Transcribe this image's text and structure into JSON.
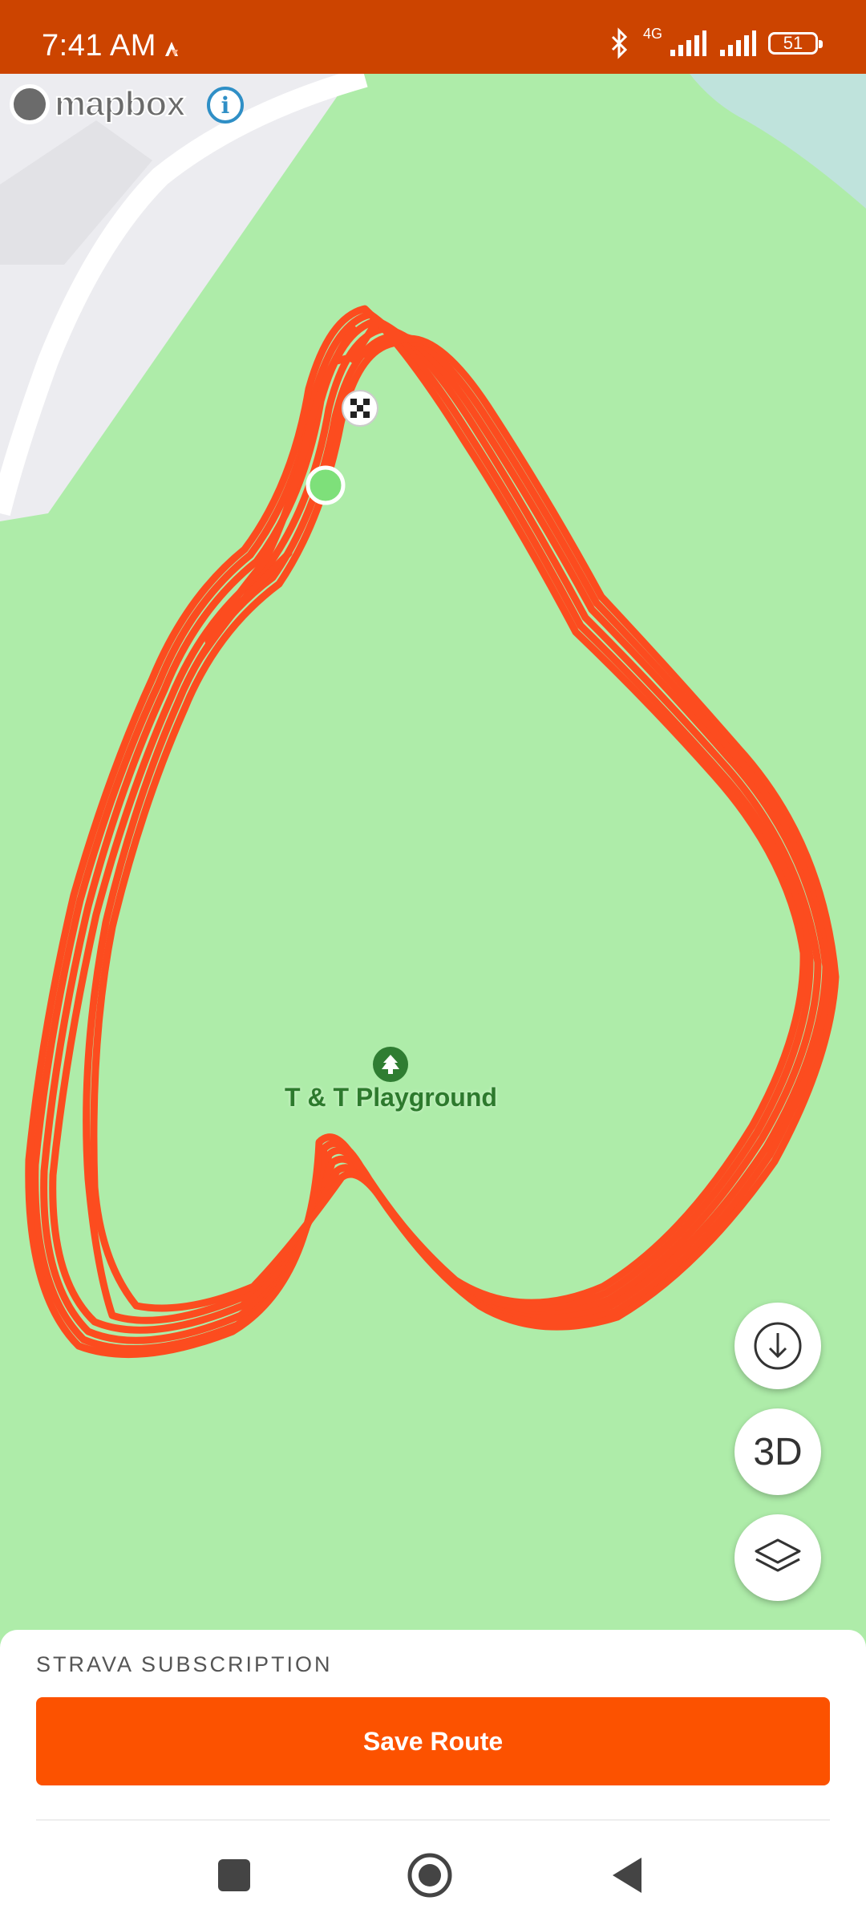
{
  "status_bar": {
    "time": "7:41 AM",
    "network": "4G",
    "battery": "51"
  },
  "map": {
    "attribution": "mapbox",
    "poi_label": "T & T Playground",
    "route_color": "#fc4c1f",
    "park_color": "#aeeca9"
  },
  "map_controls": {
    "three_d_label": "3D"
  },
  "sheet": {
    "title": "STRAVA SUBSCRIPTION",
    "save_button": "Save Route"
  },
  "colors": {
    "brand": "#fc5200",
    "status_bar": "#cc4400"
  }
}
